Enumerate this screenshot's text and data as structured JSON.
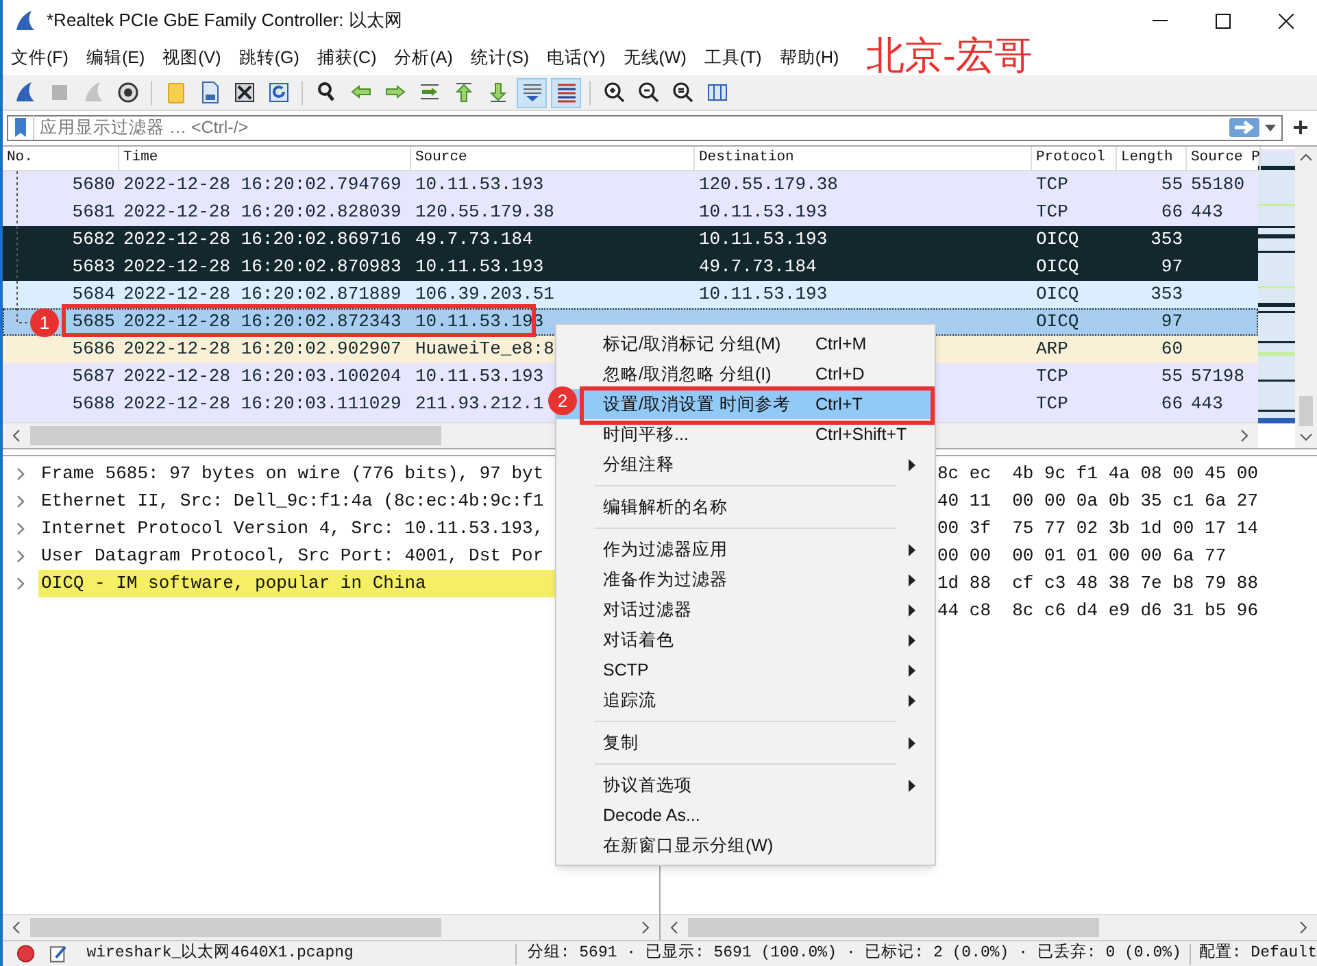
{
  "window": {
    "title": "*Realtek PCIe GbE Family Controller: 以太网"
  },
  "menu": [
    "文件(F)",
    "编辑(E)",
    "视图(V)",
    "跳转(G)",
    "捕获(C)",
    "分析(A)",
    "统计(S)",
    "电话(Y)",
    "无线(W)",
    "工具(T)",
    "帮助(H)"
  ],
  "overlay_text": "北京-宏哥",
  "toolbar": [
    {
      "kind": "start",
      "disabled": false,
      "pressed": false
    },
    {
      "kind": "stop",
      "disabled": true,
      "pressed": false
    },
    {
      "kind": "restart",
      "disabled": true,
      "pressed": false
    },
    {
      "kind": "options",
      "disabled": false,
      "pressed": false
    },
    {
      "kind": "separator"
    },
    {
      "kind": "open",
      "disabled": false,
      "pressed": false
    },
    {
      "kind": "save",
      "disabled": false,
      "pressed": false
    },
    {
      "kind": "close",
      "disabled": false,
      "pressed": false
    },
    {
      "kind": "reload",
      "disabled": false,
      "pressed": false
    },
    {
      "kind": "separator"
    },
    {
      "kind": "find",
      "disabled": false,
      "pressed": false
    },
    {
      "kind": "back",
      "disabled": false,
      "pressed": false
    },
    {
      "kind": "forward",
      "disabled": false,
      "pressed": false
    },
    {
      "kind": "goto",
      "disabled": false,
      "pressed": false
    },
    {
      "kind": "first",
      "disabled": false,
      "pressed": false
    },
    {
      "kind": "last",
      "disabled": false,
      "pressed": false
    },
    {
      "kind": "autoscroll",
      "disabled": false,
      "pressed": true
    },
    {
      "kind": "colorize",
      "disabled": false,
      "pressed": true
    },
    {
      "kind": "separator"
    },
    {
      "kind": "zoomin",
      "disabled": false,
      "pressed": false
    },
    {
      "kind": "zoomout",
      "disabled": false,
      "pressed": false
    },
    {
      "kind": "zoomreset",
      "disabled": false,
      "pressed": false
    },
    {
      "kind": "resize",
      "disabled": false,
      "pressed": false
    }
  ],
  "filter": {
    "placeholder": "应用显示过滤器 … <Ctrl-/>"
  },
  "packet_list": {
    "columns": [
      "No.",
      "Time",
      "Source",
      "Destination",
      "Protocol",
      "Length",
      "Source P"
    ],
    "rows": [
      {
        "no": "5680",
        "time": "2022-12-28 16:20:02.794769",
        "source": "10.11.53.193",
        "destination": "120.55.179.38",
        "protocol": "TCP",
        "length": "55",
        "source_port": "55180",
        "color": "#e7e6ff",
        "marked": false,
        "selected": false
      },
      {
        "no": "5681",
        "time": "2022-12-28 16:20:02.828039",
        "source": "120.55.179.38",
        "destination": "10.11.53.193",
        "protocol": "TCP",
        "length": "66",
        "source_port": "443",
        "color": "#e7e6ff",
        "marked": false,
        "selected": false
      },
      {
        "no": "5682",
        "time": "2022-12-28 16:20:02.869716",
        "source": "49.7.73.184",
        "destination": "10.11.53.193",
        "protocol": "OICQ",
        "length": "353",
        "color": "#12272e",
        "marked": true,
        "selected": false
      },
      {
        "no": "5683",
        "time": "2022-12-28 16:20:02.870983",
        "source": "10.11.53.193",
        "destination": "49.7.73.184",
        "protocol": "OICQ",
        "length": "97",
        "color": "#12272e",
        "marked": true,
        "selected": false
      },
      {
        "no": "5684",
        "time": "2022-12-28 16:20:02.871889",
        "source": "106.39.203.51",
        "destination": "10.11.53.193",
        "protocol": "OICQ",
        "length": "353",
        "color": "#daeeff",
        "marked": false,
        "selected": false
      },
      {
        "no": "5685",
        "time": "2022-12-28 16:20:02.872343",
        "source": "10.11.53.193",
        "protocol": "OICQ",
        "length": "97",
        "color": "#a7cdf0",
        "marked": false,
        "selected": true
      },
      {
        "no": "5686",
        "time": "2022-12-28 16:20:02.902907",
        "source": "HuaweiTe_e8:8",
        "protocol": "ARP",
        "length": "60",
        "color": "#faf0d7",
        "marked": false,
        "selected": false
      },
      {
        "no": "5687",
        "time": "2022-12-28 16:20:03.100204",
        "source": "10.11.53.193",
        "protocol": "TCP",
        "length": "55",
        "source_port": "57198",
        "color": "#e7e6ff",
        "marked": false,
        "selected": false
      },
      {
        "no": "5688",
        "time": "2022-12-28 16:20:03.111029",
        "source": "211.93.212.1",
        "protocol": "TCP",
        "length": "66",
        "source_port": "443",
        "color": "#e7e6ff",
        "marked": false,
        "selected": false
      }
    ]
  },
  "details": [
    {
      "text": "Frame 5685: 97 bytes on wire (776 bits), 97 byt",
      "selected": false
    },
    {
      "text": "Ethernet II, Src: Dell_9c:f1:4a (8c:ec:4b:9c:f1",
      "selected": false
    },
    {
      "text": "Internet Protocol Version 4, Src: 10.11.53.193,",
      "selected": false
    },
    {
      "text": "User Datagram Protocol, Src Port: 4001, Dst Por",
      "selected": false
    },
    {
      "text": "OICQ - IM software, popular in China",
      "selected": true
    }
  ],
  "bytes": [
    "8c ec  4b 9c f1 4a 08 00 45 00",
    "40 11  00 00 0a 0b 35 c1 6a 27",
    "00 3f  75 77 02 3b 1d 00 17 14",
    "00 00  00 01 01 00 00 6a 77",
    "1d 88  cf c3 48 38 7e b8 79 88",
    "44 c8  8c c6 d4 e9 d6 31 b5 96"
  ],
  "context_menu": [
    {
      "kind": "item",
      "label": "标记/取消标记 分组(M)",
      "shortcut": "Ctrl+M",
      "submenu": false,
      "highlighted": false
    },
    {
      "kind": "item",
      "label": "忽略/取消忽略 分组(I)",
      "shortcut": "Ctrl+D",
      "submenu": false,
      "highlighted": false
    },
    {
      "kind": "item",
      "label": "设置/取消设置 时间参考",
      "shortcut": "Ctrl+T",
      "submenu": false,
      "highlighted": true
    },
    {
      "kind": "item",
      "label": "时间平移...",
      "shortcut": "Ctrl+Shift+T",
      "submenu": false,
      "highlighted": false
    },
    {
      "kind": "item",
      "label": "分组注释",
      "submenu": true,
      "highlighted": false
    },
    {
      "kind": "separator"
    },
    {
      "kind": "item",
      "label": "编辑解析的名称",
      "submenu": false,
      "highlighted": false
    },
    {
      "kind": "separator"
    },
    {
      "kind": "item",
      "label": "作为过滤器应用",
      "submenu": true,
      "highlighted": false
    },
    {
      "kind": "item",
      "label": "准备作为过滤器",
      "submenu": true,
      "highlighted": false
    },
    {
      "kind": "item",
      "label": "对话过滤器",
      "submenu": true,
      "highlighted": false
    },
    {
      "kind": "item",
      "label": "对话着色",
      "submenu": true,
      "highlighted": false
    },
    {
      "kind": "item",
      "label": "SCTP",
      "submenu": true,
      "highlighted": false
    },
    {
      "kind": "item",
      "label": "追踪流",
      "submenu": true,
      "highlighted": false
    },
    {
      "kind": "separator"
    },
    {
      "kind": "item",
      "label": "复制",
      "submenu": true,
      "highlighted": false
    },
    {
      "kind": "separator"
    },
    {
      "kind": "item",
      "label": "协议首选项",
      "submenu": true,
      "highlighted": false
    },
    {
      "kind": "item",
      "label": "Decode As...",
      "submenu": false,
      "highlighted": false
    },
    {
      "kind": "item",
      "label": "在新窗口显示分组(W)",
      "submenu": false,
      "highlighted": false
    }
  ],
  "step_badges": [
    "1",
    "2"
  ],
  "status_bar": {
    "file": "wireshark_以太网4640X1.pcapng",
    "stats": "分组: 5691 · 已显示: 5691 (100.0%) · 已标记: 2 (0.0%) · 已丢弃: 0 (0.0%)",
    "profile": "配置: Default"
  }
}
